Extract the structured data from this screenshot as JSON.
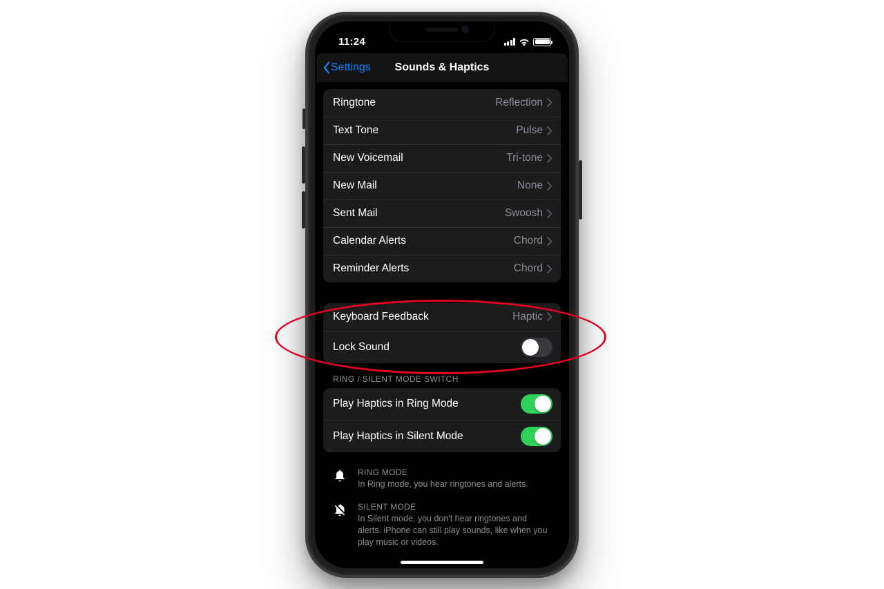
{
  "status": {
    "time": "11:24"
  },
  "nav": {
    "back": "Settings",
    "title": "Sounds & Haptics"
  },
  "sounds": [
    {
      "label": "Ringtone",
      "value": "Reflection"
    },
    {
      "label": "Text Tone",
      "value": "Pulse"
    },
    {
      "label": "New Voicemail",
      "value": "Tri-tone"
    },
    {
      "label": "New Mail",
      "value": "None"
    },
    {
      "label": "Sent Mail",
      "value": "Swoosh"
    },
    {
      "label": "Calendar Alerts",
      "value": "Chord"
    },
    {
      "label": "Reminder Alerts",
      "value": "Chord"
    }
  ],
  "feedback": {
    "keyboard": {
      "label": "Keyboard Feedback",
      "value": "Haptic"
    },
    "lock": {
      "label": "Lock Sound",
      "on": false
    }
  },
  "ring_section_header": "RING / SILENT MODE SWITCH",
  "ring": {
    "ringmode": {
      "label": "Play Haptics in Ring Mode",
      "on": true
    },
    "silentmode": {
      "label": "Play Haptics in Silent Mode",
      "on": true
    }
  },
  "info_ring": {
    "title": "RING MODE",
    "desc": "In Ring mode, you hear ringtones and alerts."
  },
  "info_silent": {
    "title": "SILENT MODE",
    "desc": "In Silent mode, you don't hear ringtones and alerts. iPhone can still play sounds, like when you play music or videos."
  }
}
